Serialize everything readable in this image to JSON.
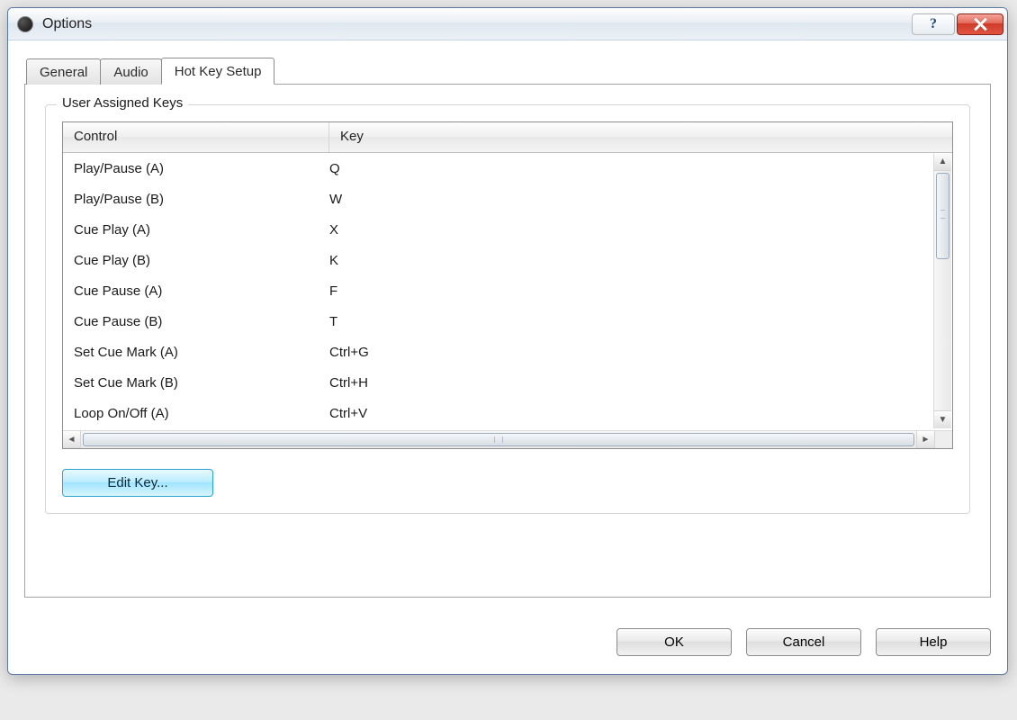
{
  "window": {
    "title": "Options"
  },
  "tabs": [
    {
      "label": "General",
      "selected": false
    },
    {
      "label": "Audio",
      "selected": false
    },
    {
      "label": "Hot Key Setup",
      "selected": true
    }
  ],
  "groupbox": {
    "legend": "User Assigned Keys"
  },
  "table": {
    "columns": [
      "Control",
      "Key"
    ],
    "rows": [
      {
        "control": "Play/Pause (A)",
        "key": "Q"
      },
      {
        "control": "Play/Pause (B)",
        "key": "W"
      },
      {
        "control": "Cue Play (A)",
        "key": "X"
      },
      {
        "control": "Cue Play (B)",
        "key": "K"
      },
      {
        "control": "Cue Pause (A)",
        "key": "F"
      },
      {
        "control": "Cue Pause (B)",
        "key": "T"
      },
      {
        "control": "Set Cue Mark (A)",
        "key": "Ctrl+G"
      },
      {
        "control": "Set Cue Mark (B)",
        "key": "Ctrl+H"
      },
      {
        "control": "Loop On/Off (A)",
        "key": "Ctrl+V"
      }
    ]
  },
  "buttons": {
    "editKey": "Edit Key...",
    "ok": "OK",
    "cancel": "Cancel",
    "help": "Help"
  }
}
